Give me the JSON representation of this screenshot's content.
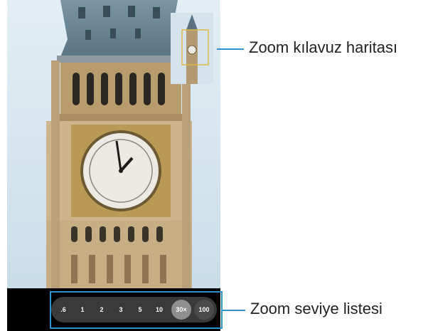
{
  "callouts": {
    "map_label": "Zoom kılavuz haritası",
    "list_label": "Zoom seviye listesi"
  },
  "zoom_levels": [
    ".6",
    "1",
    "2",
    "3",
    "5",
    "10",
    "30×",
    "100"
  ],
  "active_zoom": "30×",
  "colors": {
    "callout_accent": "#2b95c9",
    "sky": "#dfecf3",
    "stone": "#c9b08a",
    "roof": "#6f8a9a",
    "clock_gold": "#b89a55"
  }
}
